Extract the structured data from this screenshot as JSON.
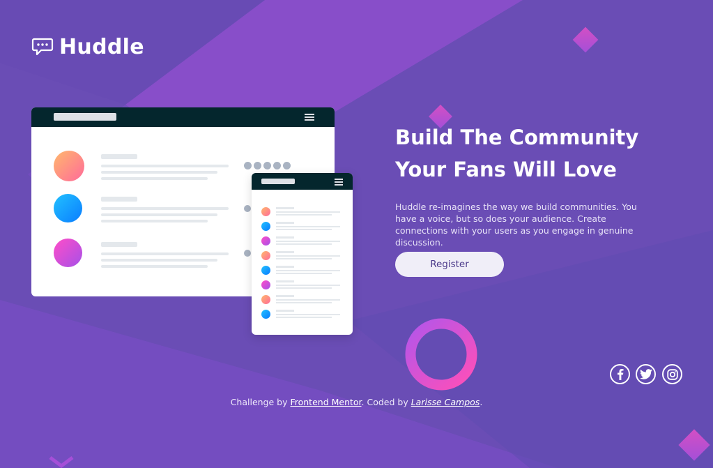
{
  "brand": {
    "name": "Huddle"
  },
  "hero": {
    "headline_line1": "Build The Community",
    "headline_line2": "Your Fans Will Love",
    "description": "Huddle re-imagines the way we build communities. You have a voice, but so does your audience. Create connections with your users as you engage in genuine discussion.",
    "register_label": "Register"
  },
  "social": [
    {
      "icon": "facebook-icon"
    },
    {
      "icon": "twitter-icon"
    },
    {
      "icon": "instagram-icon"
    }
  ],
  "footer": {
    "prefix": "Challenge by ",
    "link1": "Frontend Mentor",
    "middle": ". Coded by ",
    "link2": "Larisse Campos",
    "suffix": "."
  },
  "colors": {
    "background": "#6c4db6",
    "accent_pink": "#e650c8",
    "mock_header": "#04262d",
    "button_bg": "#f0eef8",
    "button_text": "#4b3a8a"
  }
}
